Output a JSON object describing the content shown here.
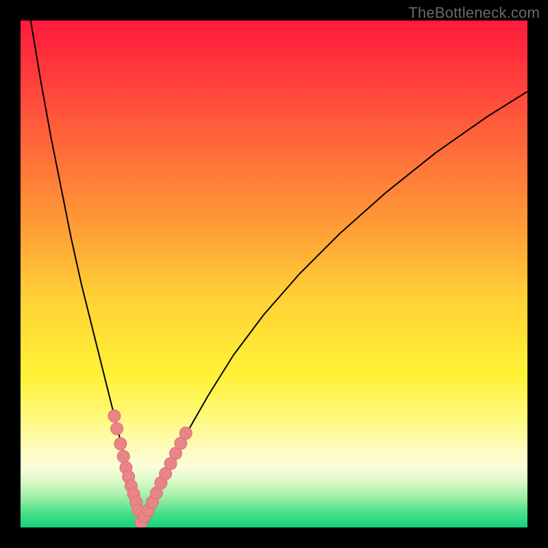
{
  "watermark": "TheBottleneck.com",
  "colors": {
    "dot_fill": "#e98488",
    "dot_stroke": "#d86f73",
    "curve_stroke": "#000000"
  },
  "chart_data": {
    "type": "line",
    "title": "",
    "xlabel": "",
    "ylabel": "",
    "xlim": [
      0,
      100
    ],
    "ylim": [
      0,
      100
    ],
    "grid": false,
    "legend": false,
    "series": [
      {
        "name": "curve-left",
        "x": [
          2,
          4,
          6,
          8,
          10,
          12,
          14,
          16,
          18,
          19,
          20,
          21,
          22,
          23,
          23.8
        ],
        "y": [
          100,
          88,
          77,
          67,
          57,
          48,
          40,
          32,
          24,
          20,
          16,
          12,
          9,
          5,
          1
        ]
      },
      {
        "name": "curve-right",
        "x": [
          23.8,
          25,
          26,
          28,
          30,
          33,
          37,
          42,
          48,
          55,
          63,
          72,
          82,
          92,
          100
        ],
        "y": [
          1,
          3,
          5,
          9,
          13,
          19,
          26,
          34,
          42,
          50,
          58,
          66,
          74,
          81,
          86
        ]
      }
    ],
    "points": {
      "name": "sample-points",
      "x": [
        18.5,
        19.0,
        19.7,
        20.3,
        20.8,
        21.3,
        21.8,
        22.3,
        22.8,
        23.2,
        23.8,
        24.5,
        25.2,
        26.0,
        26.8,
        27.7,
        28.6,
        29.6,
        30.6,
        31.6,
        32.6
      ],
      "y": [
        22.0,
        19.5,
        16.5,
        14.0,
        11.8,
        10.0,
        8.2,
        6.6,
        5.0,
        3.4,
        1.0,
        2.2,
        3.4,
        5.0,
        6.8,
        8.8,
        10.6,
        12.6,
        14.6,
        16.6,
        18.6
      ]
    }
  }
}
